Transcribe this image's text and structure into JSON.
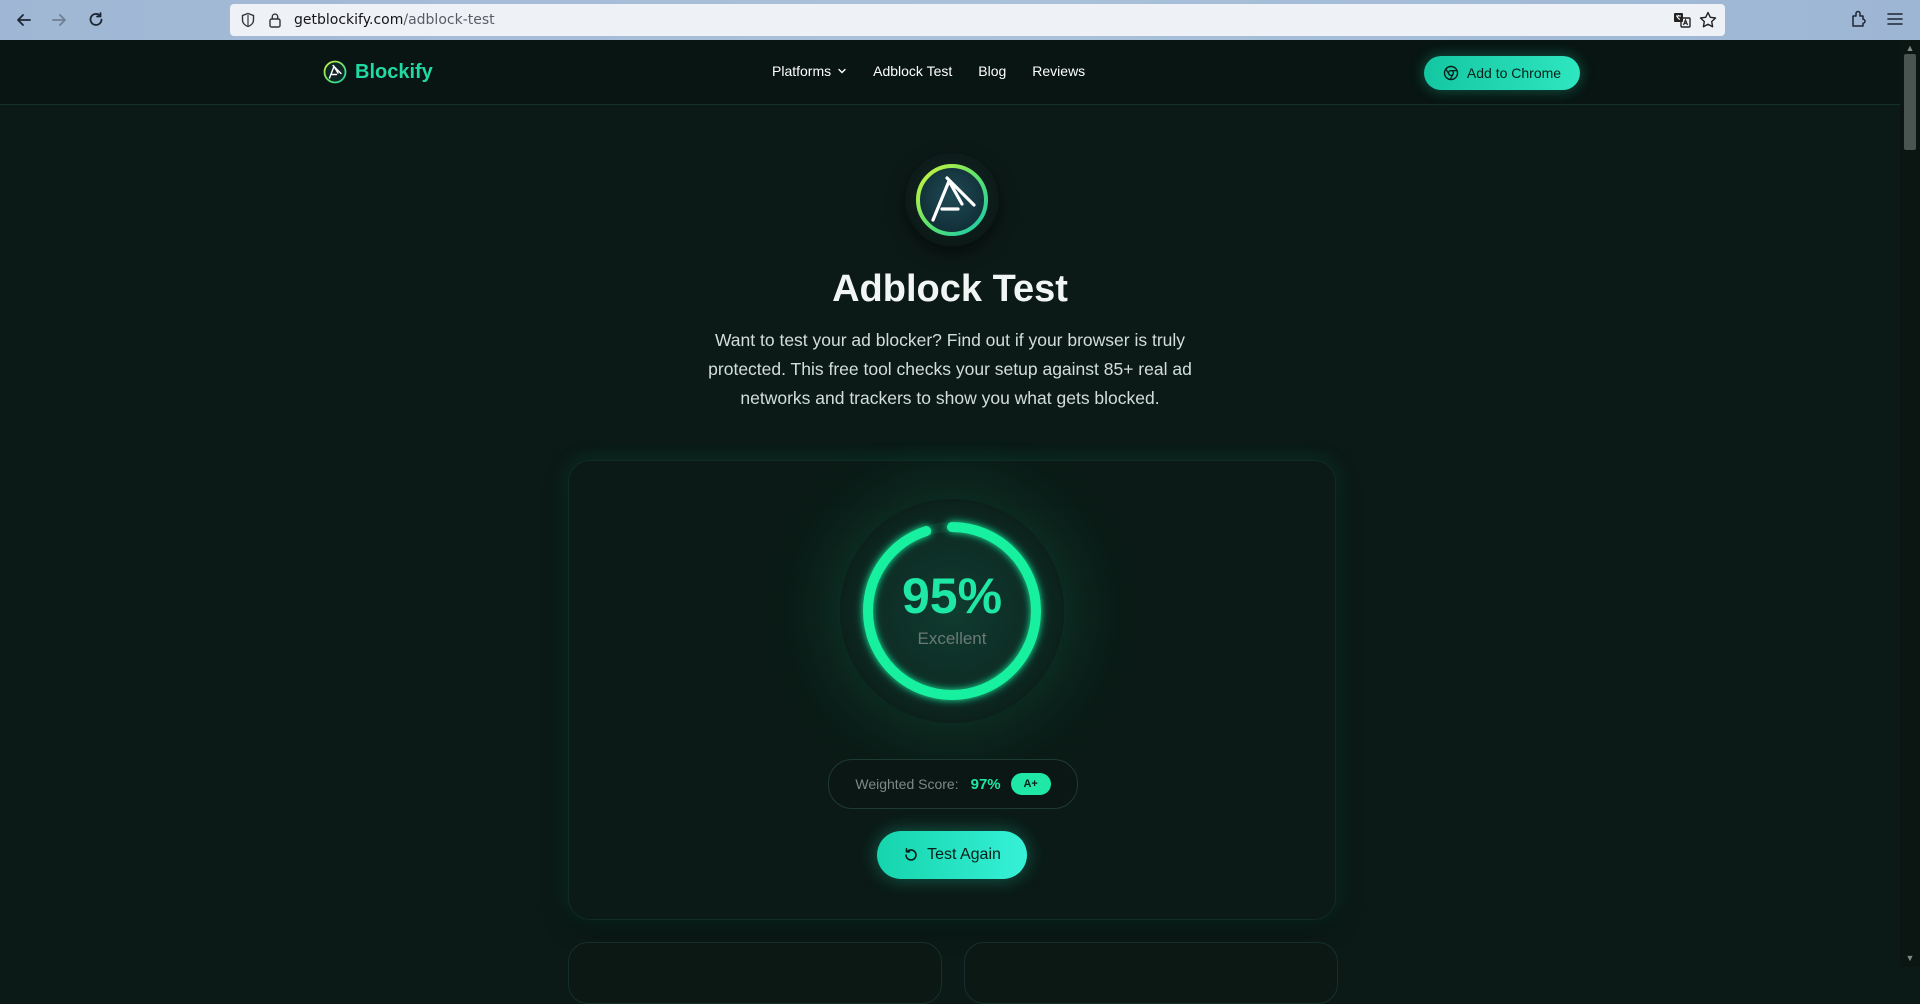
{
  "browser": {
    "url_host": "getblockify.com",
    "url_path": "/adblock-test"
  },
  "header": {
    "brand_name": "Blockify",
    "nav": [
      {
        "label": "Platforms"
      },
      {
        "label": "Adblock Test"
      },
      {
        "label": "Blog"
      },
      {
        "label": "Reviews"
      }
    ],
    "cta_label": "Add to Chrome"
  },
  "hero": {
    "title": "Adblock Test",
    "description": "Want to test your ad blocker? Find out if your browser is truly protected. This free tool checks your setup against 85+ real ad networks and trackers to show you what gets blocked."
  },
  "score": {
    "percent": 95,
    "percent_text": "95%",
    "label": "Excellent",
    "weighted_label": "Weighted Score:",
    "weighted_value": "97%",
    "grade": "A+",
    "retry_label": "Test Again"
  },
  "colors": {
    "accent": "#1fe7a5",
    "background": "#0c1a17",
    "brand": "#22d9a3"
  }
}
